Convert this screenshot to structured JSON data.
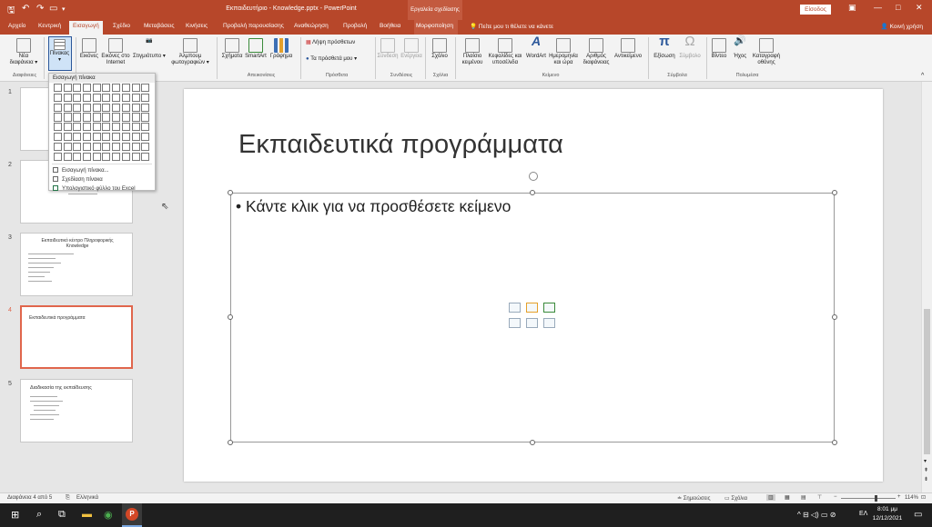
{
  "window": {
    "title": "Εκπαιδευτήριο - Knowledge.pptx - PowerPoint",
    "context_tools": "Εργαλεία σχεδίασης",
    "sign_in": "Είσοδος"
  },
  "tabs": [
    {
      "label": "Αρχείο"
    },
    {
      "label": "Κεντρική"
    },
    {
      "label": "Εισαγωγή"
    },
    {
      "label": "Σχέδιο"
    },
    {
      "label": "Μεταβάσεις"
    },
    {
      "label": "Κινήσεις"
    },
    {
      "label": "Προβολή παρουσίασης"
    },
    {
      "label": "Αναθεώρηση"
    },
    {
      "label": "Προβολή"
    },
    {
      "label": "Βοήθεια"
    },
    {
      "label": "Μορφοποίηση"
    }
  ],
  "tell_me": "Πείτε μου τι θέλετε να κάνετε",
  "share": "Κοινή χρήση",
  "ribbon": {
    "new_slide": "Νέα διαφάνεια",
    "table": "Πίνακας",
    "images": "Εικόνες",
    "online_images": "Εικόνες στο Internet",
    "screenshot": "Στιγμιότυπο",
    "photo_album": "Άλμπουμ φωτογραφιών",
    "shapes": "Σχήματα",
    "smartart": "SmartArt",
    "chart": "Γράφημα",
    "get_addins": "Λήψη πρόσθετων",
    "my_addins": "Τα πρόσθετά μου",
    "link": "Σύνδεση",
    "action": "Ενέργεια",
    "comment": "Σχόλιο",
    "textbox": "Πλαίσιο κειμένου",
    "header_footer": "Κεφαλίδες και υποσέλιδα",
    "wordart": "WordArt",
    "datetime": "Ημερομηνία και ώρα",
    "slide_number": "Αριθμός διαφάνειας",
    "object": "Αντικείμενο",
    "equation": "Εξίσωση",
    "symbol": "Σύμβολο",
    "video": "Βίντεο",
    "audio": "Ήχος",
    "screen_recording": "Καταγραφή οθόνης",
    "groups": {
      "slides": "Διαφάνειες",
      "tables": "Πίνακες",
      "illustrations": "Απεικονίσεις",
      "addins": "Πρόσθετα",
      "links": "Συνδέσεις",
      "comments": "Σχόλια",
      "text": "Κείμενο",
      "symbols": "Σύμβολα",
      "media": "Πολυμέσα"
    }
  },
  "table_dropdown": {
    "title": "Εισαγωγή πίνακα",
    "items": [
      {
        "label": "Εισαγωγή πίνακα..."
      },
      {
        "label": "Σχεδίαση πίνακα"
      },
      {
        "label": "Υπολογιστικό φύλλο του Excel"
      }
    ]
  },
  "slides": [
    {
      "number": "1"
    },
    {
      "number": "2"
    },
    {
      "number": "3",
      "title": "Εκπαιδευτικό κέντρο Πληροφορικής Knowledge"
    },
    {
      "number": "4",
      "title": "Εκπαιδευτικά προγράμματα"
    },
    {
      "number": "5",
      "title": "Διαδικασία της εκπαίδευσης"
    }
  ],
  "current_slide": {
    "title": "Εκπαιδευτικά προγράμματα",
    "placeholder_bullet": "Κάντε κλικ για να προσθέσετε κείμενο"
  },
  "status": {
    "slide_counter": "Διαφάνεια 4 από 5",
    "language": "Ελληνικά",
    "notes": "Σημειώσεις",
    "comments": "Σχόλια",
    "zoom": "114%"
  },
  "taskbar": {
    "language": "ΕΛ",
    "time": "8:01 μμ",
    "date": "12/12/2021"
  },
  "colors": {
    "accent": "#b7472a",
    "selected_thumb": "#e0664c"
  }
}
